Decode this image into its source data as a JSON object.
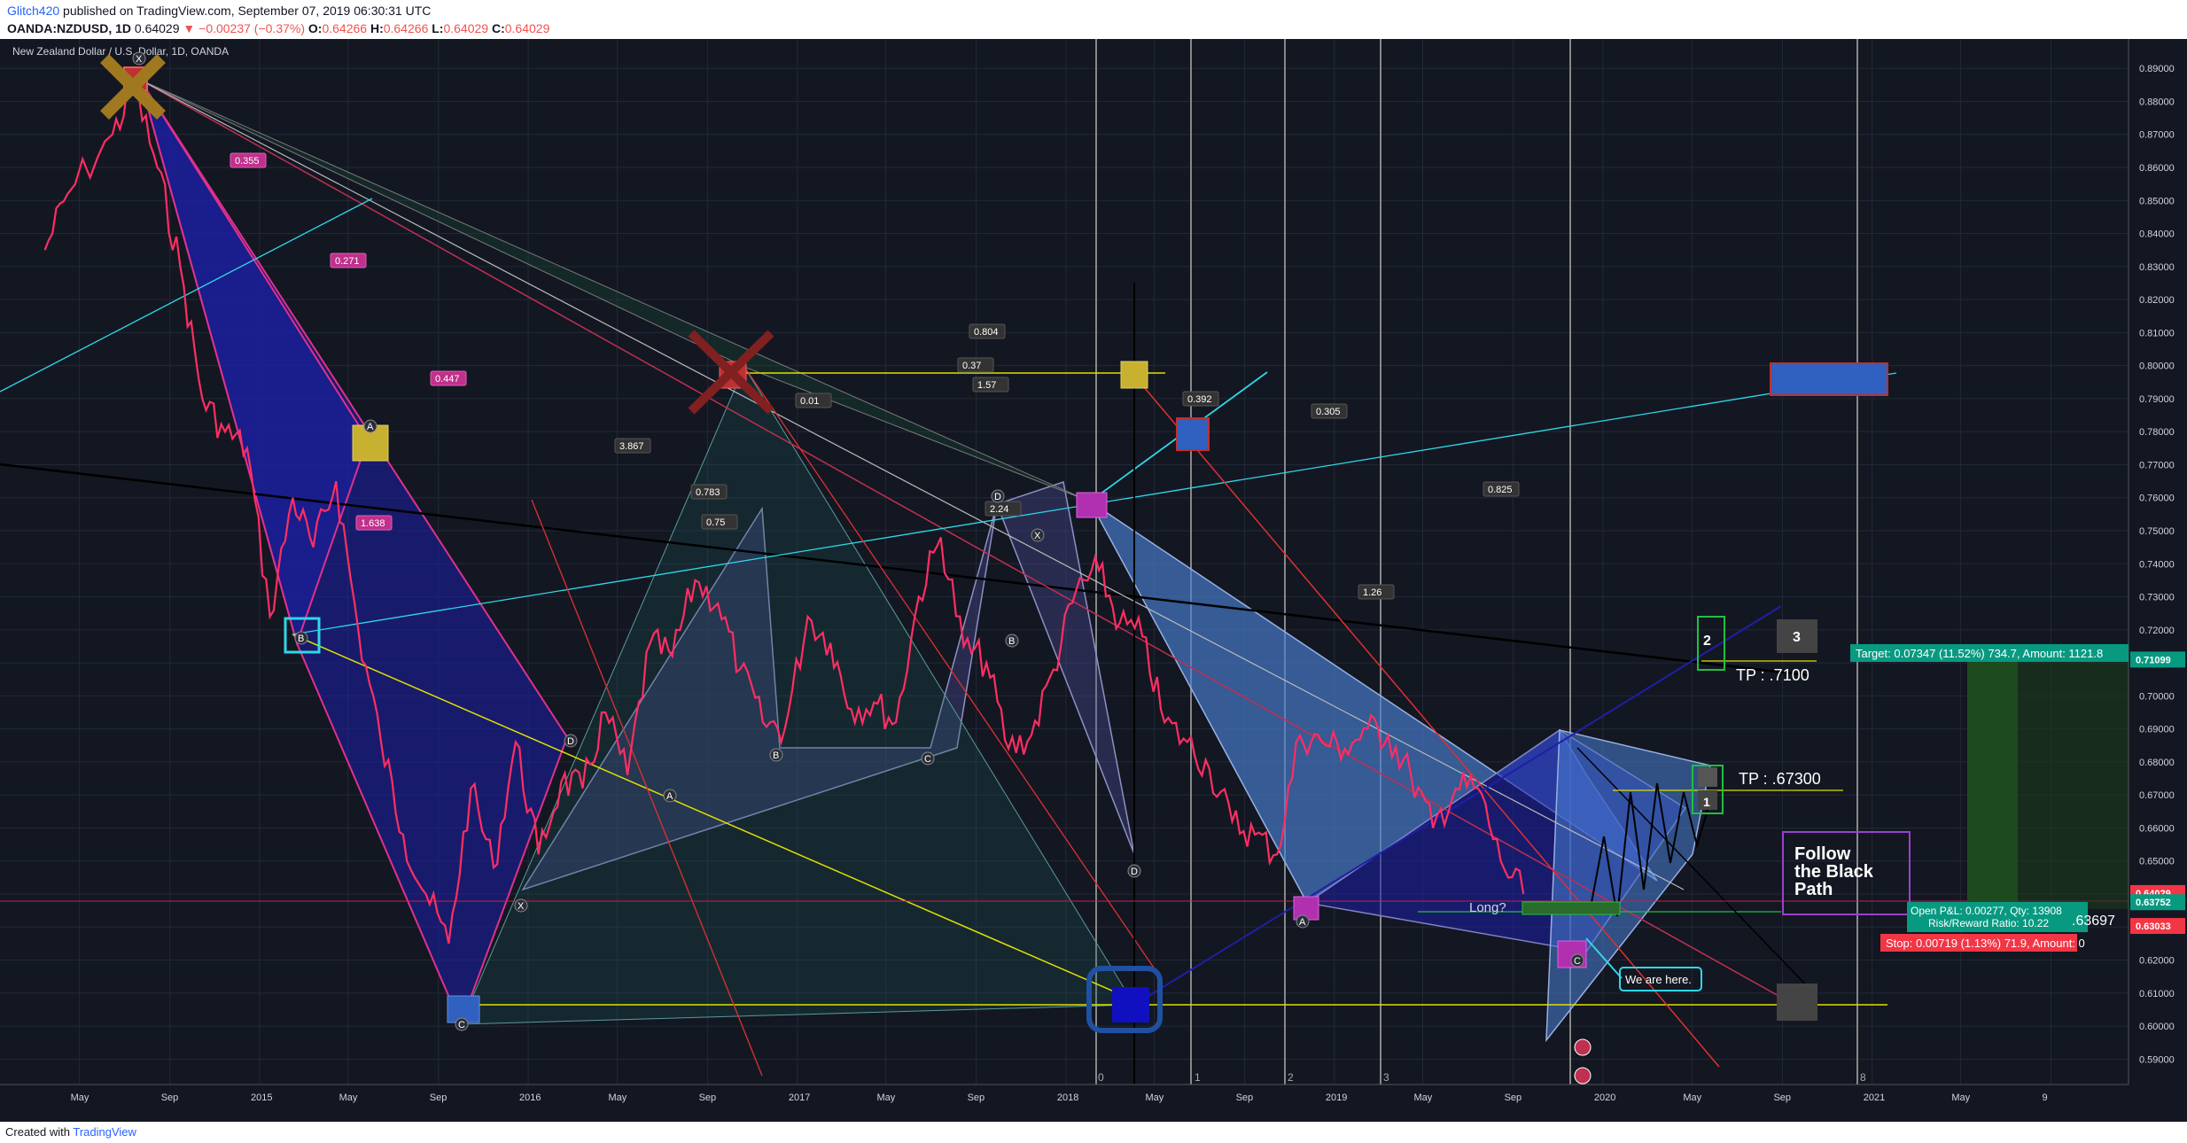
{
  "header": {
    "author": "Glitch420",
    "published": "published on TradingView.com, September 07, 2019 06:30:31 UTC",
    "symbol": "OANDA:NZDUSD, 1D",
    "last": "0.64029",
    "change": "▼ −0.00237 (−0.37%)",
    "o_label": "O:",
    "o": "0.64266",
    "h_label": "H:",
    "h": "0.64266",
    "l_label": "L:",
    "l": "0.64029",
    "c_label": "C:",
    "c": "0.64029"
  },
  "footer": {
    "created": "Created with",
    "brand": "TradingView"
  },
  "chart_data": {
    "type": "line",
    "title": "New Zealand Dollar / U.S. Dollar, 1D, OANDA",
    "y_ticks": [
      "0.89000",
      "0.88000",
      "0.87000",
      "0.86000",
      "0.85000",
      "0.84000",
      "0.83000",
      "0.82000",
      "0.81000",
      "0.80000",
      "0.79000",
      "0.78000",
      "0.77000",
      "0.76000",
      "0.75000",
      "0.74000",
      "0.73000",
      "0.72000",
      "0.71000",
      "0.70000",
      "0.69000",
      "0.68000",
      "0.67000",
      "0.66000",
      "0.65000",
      "0.64000",
      "0.63000",
      "0.62000",
      "0.61000",
      "0.60000",
      "0.59000"
    ],
    "ylim": [
      0.585,
      0.893
    ],
    "x_ticks": [
      "May",
      "Sep",
      "2015",
      "May",
      "Sep",
      "2016",
      "May",
      "Sep",
      "2017",
      "May",
      "Sep",
      "2018",
      "May",
      "Sep",
      "2019",
      "May",
      "Sep",
      "2020",
      "May",
      "Sep",
      "2021",
      "May",
      "9"
    ],
    "price_labels": [
      {
        "label": "0.71099",
        "color": "#089981"
      },
      {
        "label": "0.64029",
        "color": "#f23645"
      },
      {
        "label": "0.63752",
        "color": "#089981"
      },
      {
        "label": "0.63033",
        "color": "#f23645"
      }
    ],
    "series": [
      {
        "name": "NZDUSD",
        "x": [
          "2014-03",
          "2014-04",
          "2014-06",
          "2014-07",
          "2014-08",
          "2014-09",
          "2014-10",
          "2014-11",
          "2014-12",
          "2015-01",
          "2015-02",
          "2015-03",
          "2015-04",
          "2015-05",
          "2015-06",
          "2015-07",
          "2015-08",
          "2015-09",
          "2015-10",
          "2015-11",
          "2015-12",
          "2016-01",
          "2016-02",
          "2016-03",
          "2016-04",
          "2016-05",
          "2016-06",
          "2016-07",
          "2016-08",
          "2016-09",
          "2016-10",
          "2016-11",
          "2016-12",
          "2017-01",
          "2017-02",
          "2017-03",
          "2017-04",
          "2017-05",
          "2017-06",
          "2017-07",
          "2017-08",
          "2017-09",
          "2017-10",
          "2017-11",
          "2017-12",
          "2018-01",
          "2018-02",
          "2018-03",
          "2018-04",
          "2018-05",
          "2018-06",
          "2018-07",
          "2018-08",
          "2018-09",
          "2018-10",
          "2018-11",
          "2018-12",
          "2019-01",
          "2019-02",
          "2019-03",
          "2019-04",
          "2019-05",
          "2019-06",
          "2019-07",
          "2019-08",
          "2019-09"
        ],
        "y": [
          0.835,
          0.852,
          0.87,
          0.884,
          0.86,
          0.83,
          0.79,
          0.78,
          0.775,
          0.724,
          0.76,
          0.745,
          0.765,
          0.72,
          0.686,
          0.658,
          0.64,
          0.625,
          0.672,
          0.648,
          0.686,
          0.652,
          0.674,
          0.672,
          0.695,
          0.676,
          0.716,
          0.712,
          0.735,
          0.728,
          0.708,
          0.692,
          0.69,
          0.724,
          0.716,
          0.696,
          0.698,
          0.692,
          0.73,
          0.748,
          0.715,
          0.71,
          0.684,
          0.688,
          0.708,
          0.732,
          0.738,
          0.722,
          0.718,
          0.692,
          0.686,
          0.678,
          0.662,
          0.658,
          0.652,
          0.688,
          0.686,
          0.684,
          0.69,
          0.688,
          0.676,
          0.66,
          0.672,
          0.672,
          0.65,
          0.64
        ]
      }
    ],
    "harmonic_labels": [
      "X",
      "A",
      "B",
      "C",
      "D",
      "X",
      "A",
      "B",
      "C",
      "D",
      "X",
      "A",
      "C",
      "D",
      "B"
    ],
    "ratio_labels": [
      "0.355",
      "0.271",
      "0.447",
      "1.638",
      "3.867",
      "0.783",
      "0.75",
      "0.01",
      "0.804",
      "0.37",
      "1.57",
      "2.24",
      "0.392",
      "0.305",
      "0.825",
      "1.26"
    ],
    "annotations": {
      "tp1": "TP : .7100",
      "tp2": "TP : .67300",
      "box1": "1",
      "box2": "2",
      "box3": "3",
      "long": "Long?",
      "here": "We are here.",
      "follow": [
        "Follow",
        "the Black",
        "Path"
      ],
      "target": "Target: 0.07347 (11.52%) 734.7, Amount: 1121.8",
      "openpl": "Open P&L: 0.00277, Qty: 13908",
      "rr": "Risk/Reward Ratio: 10.22",
      "stop": "Stop: 0.00719 (1.13%) 71.9, Amount: 0",
      "partial": ".63697",
      "cycles": [
        "0",
        "1",
        "2",
        "3",
        "8"
      ]
    },
    "colors": {
      "background": "#131722",
      "price": "#ff2e63",
      "pattern_fill": "#1e1fa8",
      "pattern_fill_light": "#4a7fd4",
      "yellow_line": "#e0e000",
      "cyan_line": "#2fd8e8",
      "red_line": "#e03030",
      "green_target": "#1f7a1f",
      "red_stop": "#ff0000"
    }
  }
}
